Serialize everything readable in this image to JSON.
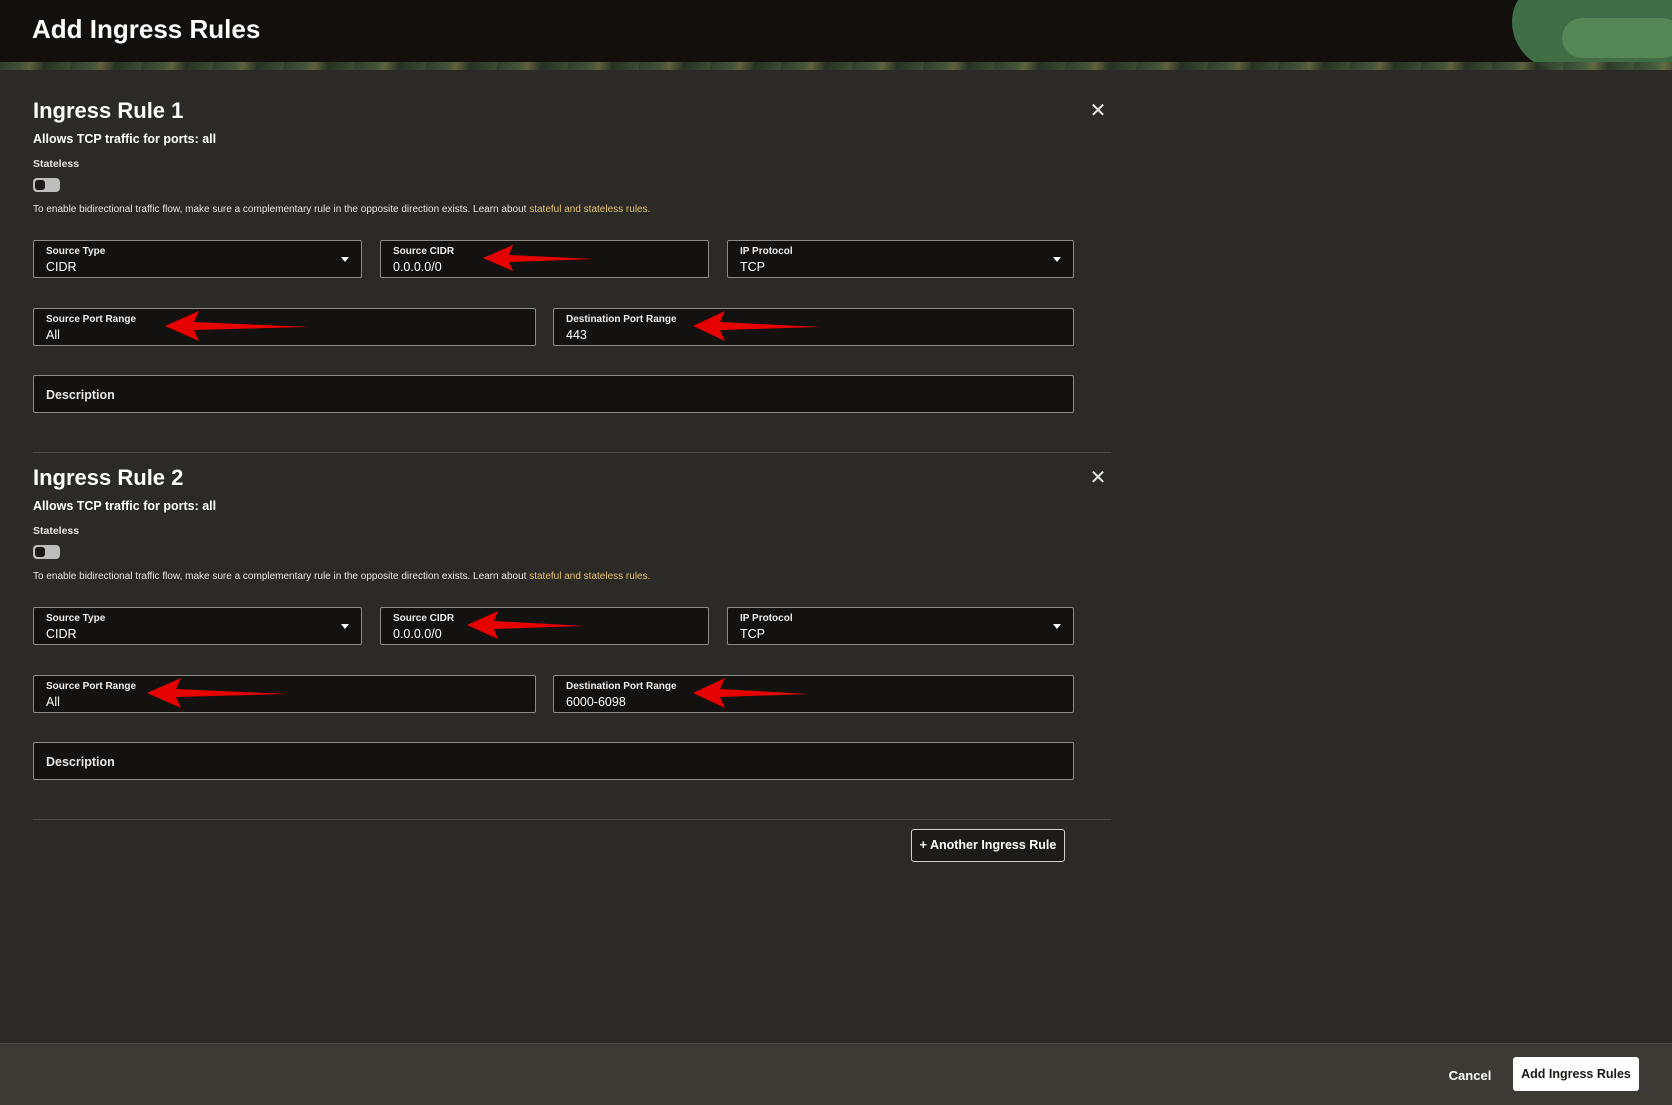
{
  "header": {
    "title": "Add Ingress Rules"
  },
  "rules": [
    {
      "title": "Ingress Rule 1",
      "allows": "Allows TCP traffic for ports: all",
      "stateless_label": "Stateless",
      "hint_text": "To enable bidirectional traffic flow, make sure a complementary rule in the opposite direction exists. Learn about ",
      "hint_link": "stateful and stateless rules.",
      "source_type": {
        "label": "Source Type",
        "value": "CIDR"
      },
      "source_cidr": {
        "label": "Source CIDR",
        "value": "0.0.0.0/0"
      },
      "ip_protocol": {
        "label": "IP Protocol",
        "value": "TCP"
      },
      "source_port": {
        "label": "Source Port Range",
        "value": "All"
      },
      "dest_port": {
        "label": "Destination Port Range",
        "value": "443"
      },
      "description": {
        "label": "Description"
      }
    },
    {
      "title": "Ingress Rule 2",
      "allows": "Allows TCP traffic for ports: all",
      "stateless_label": "Stateless",
      "hint_text": "To enable bidirectional traffic flow, make sure a complementary rule in the opposite direction exists. Learn about ",
      "hint_link": "stateful and stateless rules.",
      "source_type": {
        "label": "Source Type",
        "value": "CIDR"
      },
      "source_cidr": {
        "label": "Source CIDR",
        "value": "0.0.0.0/0"
      },
      "ip_protocol": {
        "label": "IP Protocol",
        "value": "TCP"
      },
      "source_port": {
        "label": "Source Port Range",
        "value": "All"
      },
      "dest_port": {
        "label": "Destination Port Range",
        "value": "6000-6098"
      },
      "description": {
        "label": "Description"
      }
    }
  ],
  "another_rule_label": "+ Another Ingress Rule",
  "footer": {
    "cancel_label": "Cancel",
    "submit_label": "Add Ingress Rules"
  },
  "icons": {
    "close": "close-icon",
    "dropdown": "chevron-down-icon",
    "annotation": "red-arrow-icon"
  },
  "colors": {
    "link": "#e5c26b",
    "annotation_arrow": "#e60000",
    "background": "#2c2a27"
  }
}
